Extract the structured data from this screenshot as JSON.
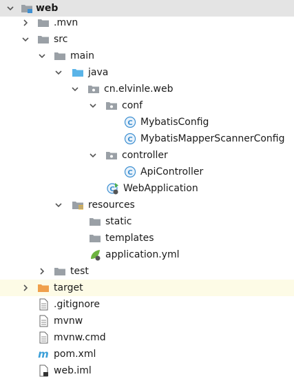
{
  "tree": {
    "root": {
      "label": "web",
      "icon": "module-folder-icon",
      "expanded": true
    },
    "mvn": {
      "label": ".mvn",
      "icon": "folder-icon",
      "expanded": false
    },
    "src": {
      "label": "src",
      "icon": "folder-icon",
      "expanded": true
    },
    "main": {
      "label": "main",
      "icon": "folder-icon",
      "expanded": true
    },
    "java": {
      "label": "java",
      "icon": "source-folder-icon",
      "expanded": true
    },
    "package": {
      "label": "cn.elvinle.web",
      "icon": "package-icon",
      "expanded": true
    },
    "conf": {
      "label": "conf",
      "icon": "package-icon",
      "expanded": true
    },
    "mybatis_config": {
      "label": "MybatisConfig",
      "icon": "class-icon"
    },
    "mybatis_scanner_config": {
      "label": "MybatisMapperScannerConfig",
      "icon": "class-icon"
    },
    "controller": {
      "label": "controller",
      "icon": "package-icon",
      "expanded": true
    },
    "api_controller": {
      "label": "ApiController",
      "icon": "class-icon"
    },
    "web_application": {
      "label": "WebApplication",
      "icon": "spring-boot-class-icon"
    },
    "resources": {
      "label": "resources",
      "icon": "resources-folder-icon",
      "expanded": true
    },
    "static": {
      "label": "static",
      "icon": "folder-icon"
    },
    "templates": {
      "label": "templates",
      "icon": "folder-icon"
    },
    "application_yml": {
      "label": "application.yml",
      "icon": "spring-config-icon"
    },
    "test": {
      "label": "test",
      "icon": "folder-icon",
      "expanded": false
    },
    "target": {
      "label": "target",
      "icon": "excluded-folder-icon",
      "expanded": false
    },
    "gitignore": {
      "label": ".gitignore",
      "icon": "text-file-icon"
    },
    "mvnw": {
      "label": "mvnw",
      "icon": "text-file-icon"
    },
    "mvnw_cmd": {
      "label": "mvnw.cmd",
      "icon": "text-file-icon"
    },
    "pom_xml": {
      "label": "pom.xml",
      "icon": "maven-icon"
    },
    "web_iml": {
      "label": "web.iml",
      "icon": "module-file-icon"
    }
  },
  "colors": {
    "folder": "#9aa0a6",
    "source_folder": "#5ab4e8",
    "excluded_folder": "#f0a04b",
    "class_circle": "#3d8fd1",
    "selection": "#e4e4e4",
    "target_row": "#fdfbe6",
    "maven": "#3b9fd8",
    "spring": "#6db33f"
  }
}
